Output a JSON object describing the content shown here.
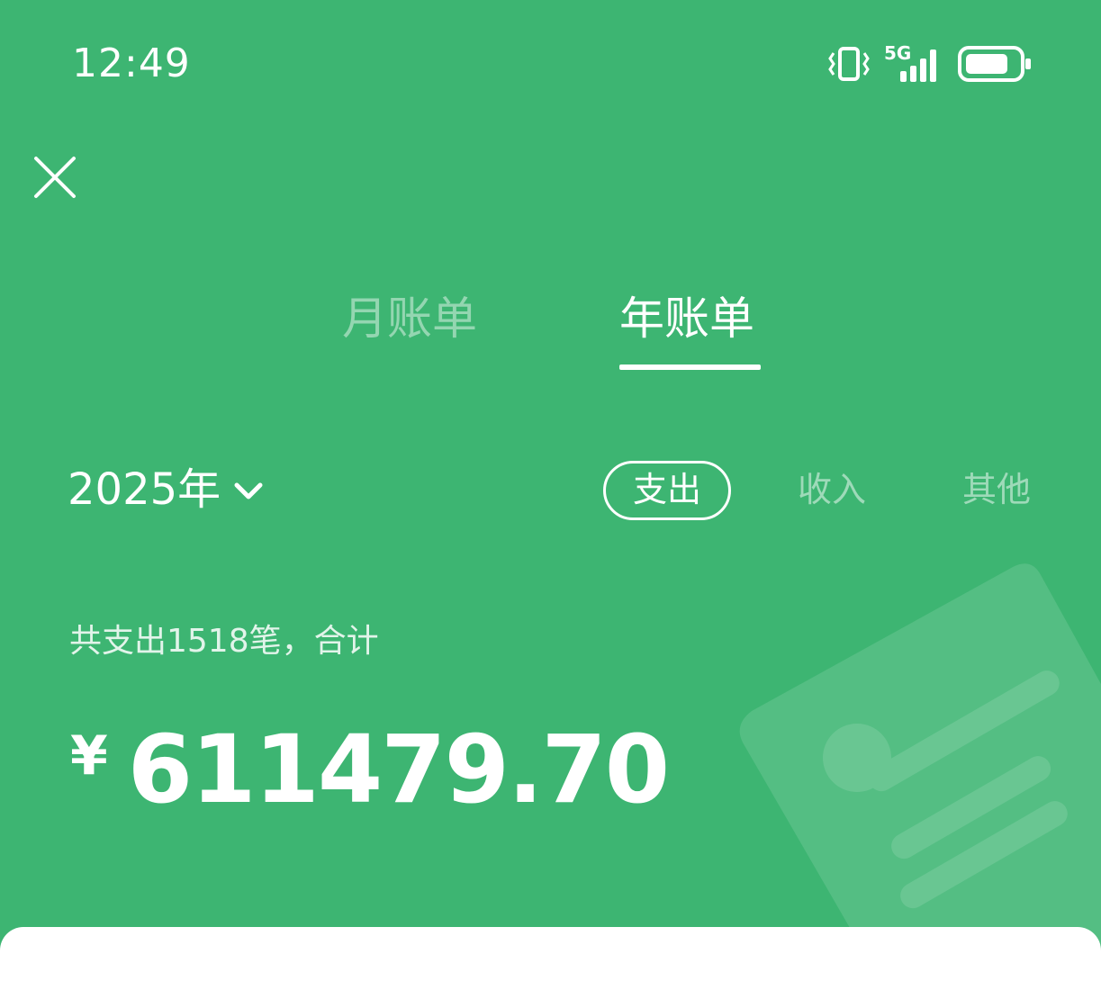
{
  "status_bar": {
    "time": "12:49",
    "network": "5G",
    "icons": [
      "vibrate-icon",
      "signal-icon",
      "battery-icon"
    ]
  },
  "header": {
    "close_icon": "close-icon"
  },
  "tabs": [
    {
      "label": "月账单",
      "active": false
    },
    {
      "label": "年账单",
      "active": true
    }
  ],
  "year_selector": {
    "value": "2025年",
    "icon": "chevron-down-icon"
  },
  "filters": [
    {
      "label": "支出",
      "active": true
    },
    {
      "label": "收入",
      "active": false
    },
    {
      "label": "其他",
      "active": false
    }
  ],
  "summary": {
    "caption": "共支出1518笔，合计",
    "currency": "¥",
    "amount": "611479.70"
  },
  "colors": {
    "background": "#3db572",
    "foreground": "#ffffff"
  }
}
